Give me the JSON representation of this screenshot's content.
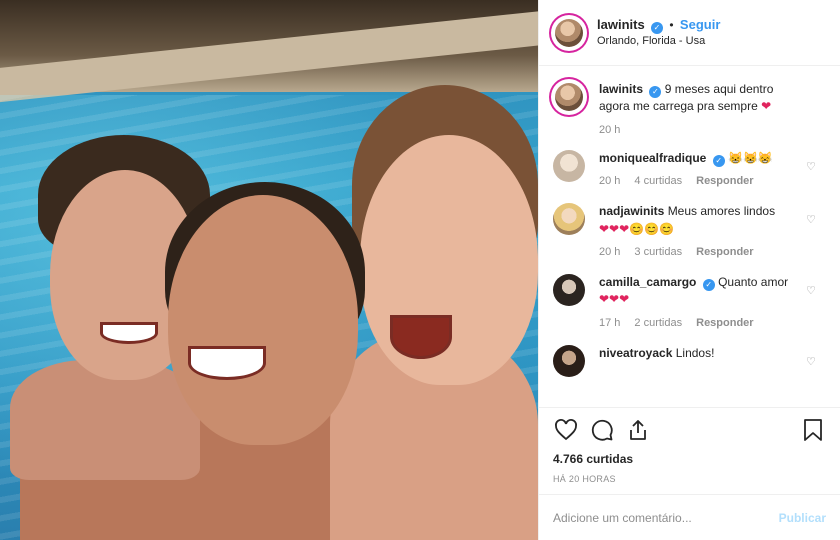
{
  "post": {
    "author": "lawinits",
    "follow_label": "Seguir",
    "dot": "•",
    "location": "Orlando, Florida - Usa",
    "caption": "9 meses aqui dentro agora me carrega pra sempre",
    "caption_emoji": "❤",
    "caption_time": "20 h"
  },
  "comments": [
    {
      "user": "moniquealfradique",
      "verified": true,
      "text": "😸😸😸",
      "time": "20 h",
      "likes": "4 curtidas",
      "reply": "Responder"
    },
    {
      "user": "nadjawinits",
      "verified": false,
      "text": "Meus amores lindos",
      "emoji": "❤❤❤😊😊😊",
      "time": "20 h",
      "likes": "3 curtidas",
      "reply": "Responder"
    },
    {
      "user": "camilla_camargo",
      "verified": true,
      "text": "Quanto amor",
      "emoji": "❤❤❤",
      "time": "17 h",
      "likes": "2 curtidas",
      "reply": "Responder"
    },
    {
      "user": "niveatroyack",
      "verified": false,
      "text": "Lindos!"
    }
  ],
  "footer": {
    "likes": "4.766 curtidas",
    "time_ago": "HÁ 20 HORAS",
    "comment_placeholder": "Adicione um comentário...",
    "publish_label": "Publicar"
  },
  "icons": {
    "like": "heart-icon",
    "comment": "comment-icon",
    "share": "share-icon",
    "save": "bookmark-icon",
    "verified": "verified-badge-icon"
  },
  "colors": {
    "accent": "#3897f0",
    "ring": "#d6249f",
    "heart": "#e0245e",
    "muted": "#8e8e8e",
    "publish_disabled": "#b2dffc"
  }
}
